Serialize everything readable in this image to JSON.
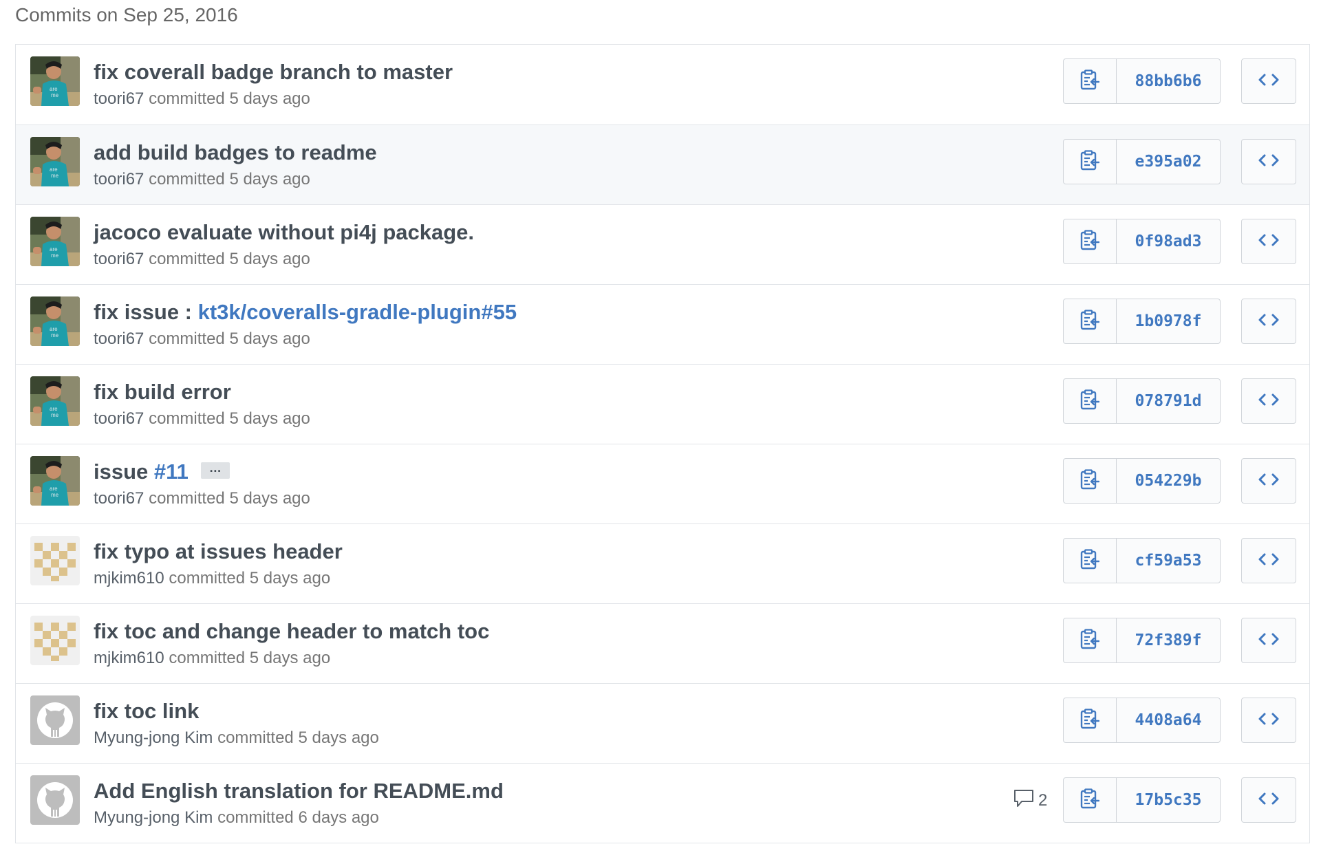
{
  "date_header": "Commits on Sep 25, 2016",
  "committed_word": "committed",
  "commits": [
    {
      "title": "fix coverall badge branch to master",
      "title_link": "",
      "author": "toori67",
      "time": "5 days ago",
      "sha": "88bb6b6",
      "avatar": "photo",
      "comments": ""
    },
    {
      "title": "add build badges to readme",
      "title_link": "",
      "author": "toori67",
      "time": "5 days ago",
      "sha": "e395a02",
      "avatar": "photo",
      "comments": ""
    },
    {
      "title": "jacoco evaluate without pi4j package.",
      "title_link": "",
      "author": "toori67",
      "time": "5 days ago",
      "sha": "0f98ad3",
      "avatar": "photo",
      "comments": ""
    },
    {
      "title": "fix issue : ",
      "title_link": "kt3k/coveralls-gradle-plugin#55",
      "author": "toori67",
      "time": "5 days ago",
      "sha": "1b0978f",
      "avatar": "photo",
      "comments": ""
    },
    {
      "title": "fix build error",
      "title_link": "",
      "author": "toori67",
      "time": "5 days ago",
      "sha": "078791d",
      "avatar": "photo",
      "comments": ""
    },
    {
      "title": "issue ",
      "title_link": "#11",
      "author": "toori67",
      "time": "5 days ago",
      "sha": "054229b",
      "avatar": "photo",
      "comments": "",
      "has_ellipsis": true,
      "ellipsis": "…"
    },
    {
      "title": "fix typo at issues header",
      "title_link": "",
      "author": "mjkim610",
      "time": "5 days ago",
      "sha": "cf59a53",
      "avatar": "identicon",
      "comments": ""
    },
    {
      "title": "fix toc and change header to match toc",
      "title_link": "",
      "author": "mjkim610",
      "time": "5 days ago",
      "sha": "72f389f",
      "avatar": "identicon",
      "comments": ""
    },
    {
      "title": "fix toc link",
      "title_link": "",
      "author": "Myung-jong Kim",
      "time": "5 days ago",
      "sha": "4408a64",
      "avatar": "octocat",
      "comments": ""
    },
    {
      "title": "Add English translation for README.md",
      "title_link": "",
      "author": "Myung-jong Kim",
      "time": "6 days ago",
      "sha": "17b5c35",
      "avatar": "octocat",
      "comments": "2"
    }
  ],
  "icons": {
    "copy": "clipboard-icon",
    "browse": "code-icon",
    "comment": "comment-icon"
  },
  "colors": {
    "link": "#4078c0",
    "title": "#444d56",
    "meta": "#767676",
    "border": "#e1e4e8",
    "highlight_row": "#f6f8fa",
    "identicon": "#dcc28c"
  }
}
